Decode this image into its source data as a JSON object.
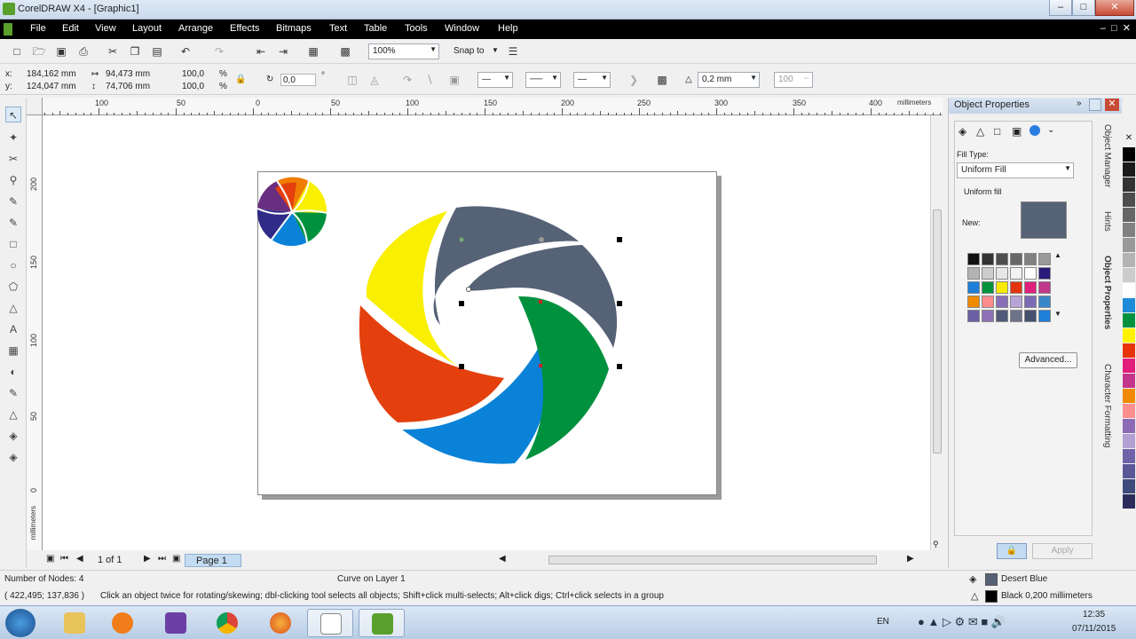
{
  "window": {
    "title": "CorelDRAW X4 - [Graphic1]"
  },
  "window_controls": {
    "minimize": "–",
    "maximize": "□",
    "close": "✕"
  },
  "menu": [
    "File",
    "Edit",
    "View",
    "Layout",
    "Arrange",
    "Effects",
    "Bitmaps",
    "Text",
    "Table",
    "Tools",
    "Window",
    "Help"
  ],
  "standard_toolbar": {
    "zoom": "100%",
    "snap_to": "Snap to"
  },
  "property_bar": {
    "x": "184,162 mm",
    "y": "124,047 mm",
    "w": "94,473 mm",
    "h": "74,706 mm",
    "scale_x": "100,0",
    "scale_y": "100,0",
    "percent": "%",
    "rotation": "0,0",
    "degree": "°",
    "outline_width": "0,2 mm",
    "curve_smoothness": "100"
  },
  "rulers": {
    "h_ticks": [
      "100",
      "50",
      "0",
      "50",
      "100",
      "150",
      "200",
      "250",
      "300",
      "350",
      "400"
    ],
    "units": "millimeters",
    "v_ticks": [
      "200",
      "150",
      "100",
      "50",
      "0"
    ],
    "v_units": "millimeters"
  },
  "page_nav": {
    "position": "1 of 1",
    "tab": "Page 1"
  },
  "docker": {
    "title": "Object Properties",
    "fill_type_label": "Fill Type:",
    "fill_type": "Uniform Fill",
    "fill_desc": "Uniform fill",
    "new_label": "New:",
    "new_color": "#566276",
    "advanced_button": "Advanced...",
    "apply_button": "Apply",
    "swatches": [
      [
        "#111111",
        "#333333",
        "#4d4d4d",
        "#666666",
        "#808080",
        "#999999"
      ],
      [
        "#b3b3b3",
        "#cccccc",
        "#e6e6e6",
        "#f2f2f2",
        "#ffffff",
        "#2a1a7a"
      ],
      [
        "#1e7fd8",
        "#00933b",
        "#f8e900",
        "#e3340f",
        "#e01f7d",
        "#c0398b"
      ],
      [
        "#f08a00",
        "#ff8c8c",
        "#8a6fb8",
        "#b7a3d6",
        "#7b6bb2",
        "#3b86c6"
      ],
      [
        "#6a5fa4",
        "#8d73b6",
        "#505a78",
        "#6a7388",
        "#45506e",
        "#1e7fd8"
      ]
    ]
  },
  "side_tabs": [
    "Object Manager",
    "Hints",
    "Object Properties",
    "Character Formatting"
  ],
  "palette": [
    "#000000",
    "#1a1a1a",
    "#333333",
    "#4d4d4d",
    "#666666",
    "#808080",
    "#999999",
    "#b3b3b3",
    "#cccccc",
    "#ffffff",
    "#1f8ad8",
    "#00923f",
    "#fff200",
    "#e8340c",
    "#e21d7c",
    "#c3348b",
    "#f08a00",
    "#ff8f8f",
    "#8c6bb4",
    "#b3a0d3",
    "#6f62a8",
    "#5a5797",
    "#3f4b7a",
    "#2c2c5c"
  ],
  "status": {
    "nodes": "Number of Nodes: 4",
    "object": "Curve on Layer 1",
    "fill_name": "Desert Blue",
    "fill_color": "#566276",
    "outline": "Black  0,200 millimeters",
    "coords": "( 422,495; 137,836 )",
    "hint": "Click an object twice for rotating/skewing; dbl-clicking tool selects all objects; Shift+click multi-selects; Alt+click digs; Ctrl+click selects in a group"
  },
  "taskbar": {
    "time": "12:35",
    "date": "07/11/2015",
    "lang": "EN"
  },
  "artwork": {
    "colors": {
      "slate": "#566276",
      "yellow": "#f8f000",
      "red": "#e3400d",
      "blue": "#0a82d8",
      "green": "#00913f",
      "purple": "#2f2b86",
      "orange": "#f07c00",
      "violet": "#6a2e80"
    }
  }
}
